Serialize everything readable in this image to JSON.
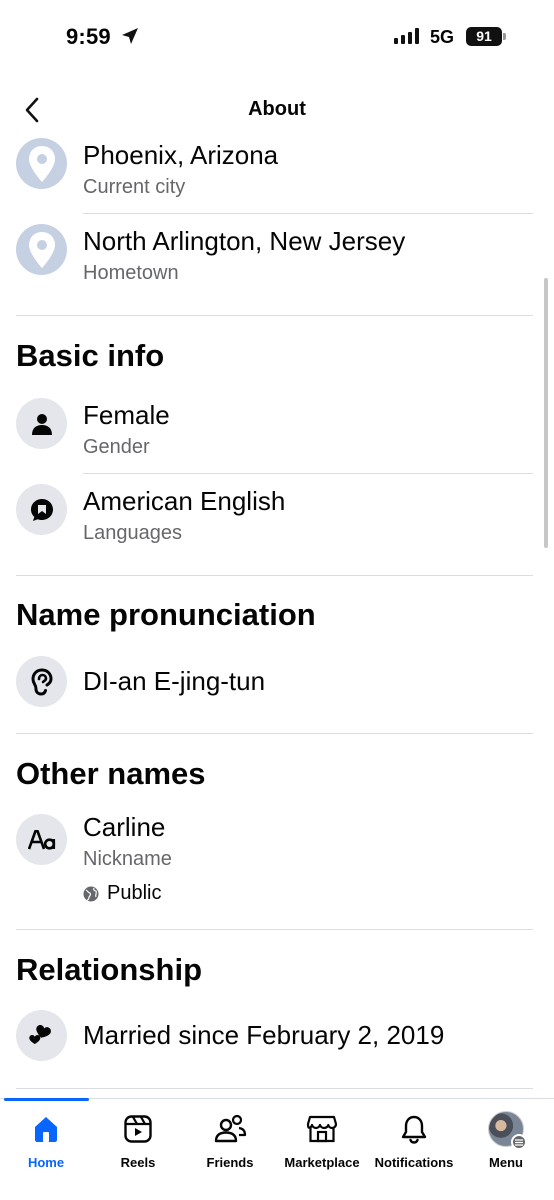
{
  "status_bar": {
    "time": "9:59",
    "network": "5G",
    "battery": "91"
  },
  "header": {
    "title": "About"
  },
  "places": [
    {
      "primary": "Phoenix, Arizona",
      "secondary": "Current city",
      "icon": "location-pin-icon"
    },
    {
      "primary": "North Arlington, New Jersey",
      "secondary": "Hometown",
      "icon": "location-pin-icon"
    }
  ],
  "basic_info": {
    "title": "Basic info",
    "items": [
      {
        "primary": "Female",
        "secondary": "Gender",
        "icon": "person-icon"
      },
      {
        "primary": "American English",
        "secondary": "Languages",
        "icon": "speech-bubble-icon"
      }
    ]
  },
  "name_pronunciation": {
    "title": "Name pronunciation",
    "value": "DI-an E-jing-tun",
    "icon": "ear-icon"
  },
  "other_names": {
    "title": "Other names",
    "primary": "Carline",
    "secondary": "Nickname",
    "privacy": "Public",
    "icon": "text-aa-icon"
  },
  "relationship": {
    "title": "Relationship",
    "value": "Married since February 2, 2019",
    "icon": "hearts-icon"
  },
  "bottom_nav": {
    "items": [
      {
        "label": "Home",
        "active": true
      },
      {
        "label": "Reels"
      },
      {
        "label": "Friends"
      },
      {
        "label": "Marketplace"
      },
      {
        "label": "Notifications"
      },
      {
        "label": "Menu"
      }
    ],
    "active_color": "#0866ff"
  }
}
